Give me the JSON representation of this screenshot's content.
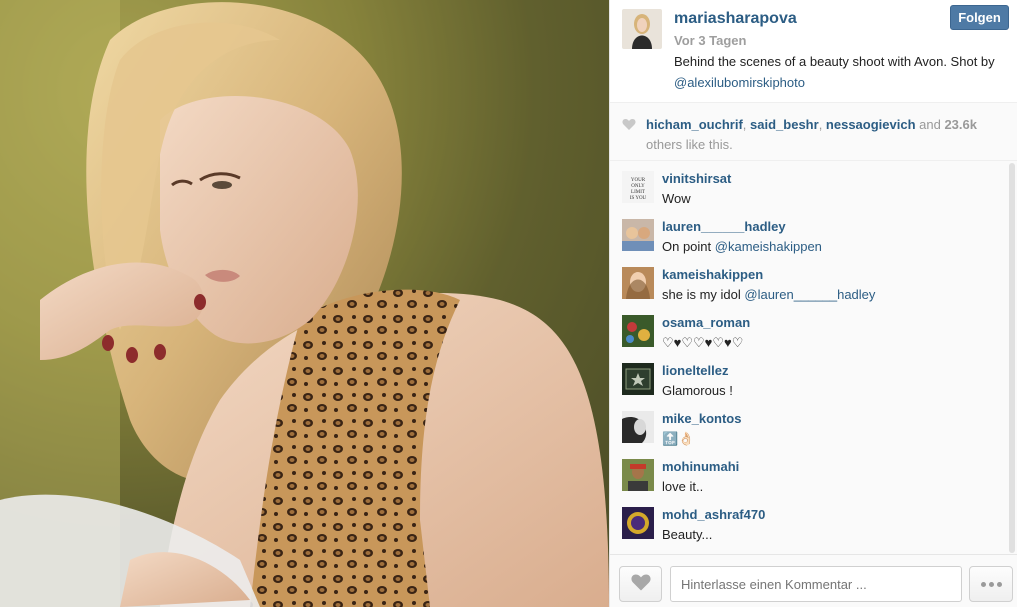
{
  "post": {
    "username": "mariasharapova",
    "time": "Vor 3 Tagen",
    "caption_text": "Behind the scenes of a beauty shoot with Avon. Shot by ",
    "caption_mention": "@alexilubomirskiphoto",
    "follow_label": "Folgen",
    "image_description_icon": "photo-image"
  },
  "likes": {
    "user1": "hicham_ouchrif",
    "sep1": ", ",
    "user2": "said_beshr",
    "sep2": ", ",
    "user3": "nessaogievich",
    "and": " and ",
    "count": "23.6k",
    "tail": "others like this."
  },
  "comments": [
    {
      "user": "vinitshirsat",
      "text": "Wow",
      "mention": ""
    },
    {
      "user": "lauren______hadley",
      "text": "On point ",
      "mention": "@kameishakippen"
    },
    {
      "user": "kameishakippen",
      "text": "she is my idol ",
      "mention": "@lauren______hadley"
    },
    {
      "user": "osama_roman",
      "text": "♡♥♡♡♥♡♥♡",
      "mention": ""
    },
    {
      "user": "lioneltellez",
      "text": "Glamorous !",
      "mention": ""
    },
    {
      "user": "mike_kontos",
      "text": "🔝👌🏻",
      "mention": ""
    },
    {
      "user": "mohinumahi",
      "text": "love it..",
      "mention": ""
    },
    {
      "user": "mohd_ashraf470",
      "text": "Beauty...",
      "mention": ""
    }
  ],
  "footer": {
    "comment_placeholder": "Hinterlasse einen Kommentar ..."
  },
  "colors": {
    "link": "#2c5d84",
    "follow_bg": "#4e7aa5"
  }
}
